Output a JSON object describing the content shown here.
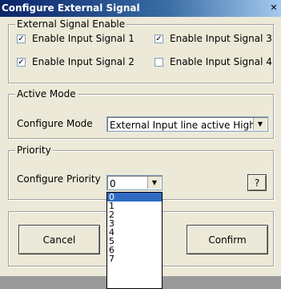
{
  "window": {
    "title": "Configure External Signal"
  },
  "signal_group": {
    "title": "External Signal Enable",
    "checkboxes": [
      {
        "label": "Enable Input Signal 1",
        "checked": true
      },
      {
        "label": "Enable Input Signal 3",
        "checked": true
      },
      {
        "label": "Enable Input Signal 2",
        "checked": true
      },
      {
        "label": "Enable Input Signal 4",
        "checked": false
      }
    ]
  },
  "mode_group": {
    "title": "Active Mode",
    "label": "Configure Mode",
    "selected": "External Input line active High"
  },
  "priority_group": {
    "title": "Priority",
    "label": "Configure Priority",
    "selected": "0",
    "help_label": "?",
    "options": [
      "0",
      "1",
      "2",
      "3",
      "4",
      "5",
      "6",
      "7"
    ]
  },
  "buttons": {
    "cancel": "Cancel",
    "confirm": "Confirm"
  },
  "colors": {
    "selection": "#316ac5",
    "titlebar": "#0a246a"
  }
}
